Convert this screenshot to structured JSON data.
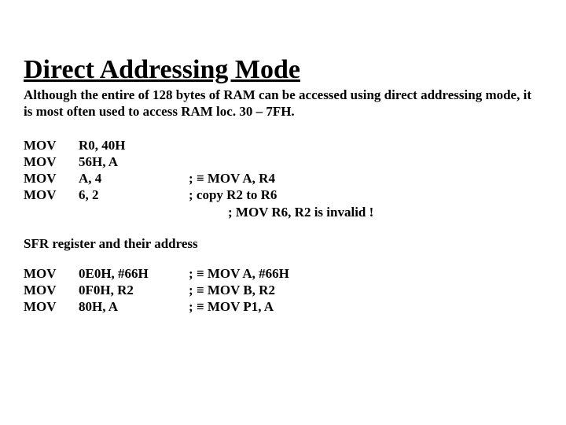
{
  "title": "Direct Addressing Mode",
  "intro": "Although the entire of 128 bytes of RAM can be accessed using direct addressing mode, it is most often used to access RAM loc. 30 – 7FH.",
  "block1": {
    "r0": {
      "op": "MOV",
      "args": "R0, 40H",
      "cmt": ""
    },
    "r1": {
      "op": "MOV",
      "args": "56H, A",
      "cmt": ""
    },
    "r2": {
      "op": "MOV",
      "args": "A, 4",
      "cmt": "; ≡ MOV A, R4"
    },
    "r3": {
      "op": "MOV",
      "args": "6, 2",
      "cmt": "; copy R2 to R6"
    }
  },
  "invalid_note": "; MOV  R6, R2 is invalid !",
  "subheading": "SFR register and their address",
  "block2": {
    "r0": {
      "op": "MOV",
      "args": "0E0H, #66H",
      "cmt": "; ≡ MOV A, #66H"
    },
    "r1": {
      "op": "MOV",
      "args": "0F0H, R2",
      "cmt": "; ≡ MOV B, R2"
    },
    "r2": {
      "op": "MOV",
      "args": "80H, A",
      "cmt": "; ≡ MOV P1, A"
    }
  }
}
